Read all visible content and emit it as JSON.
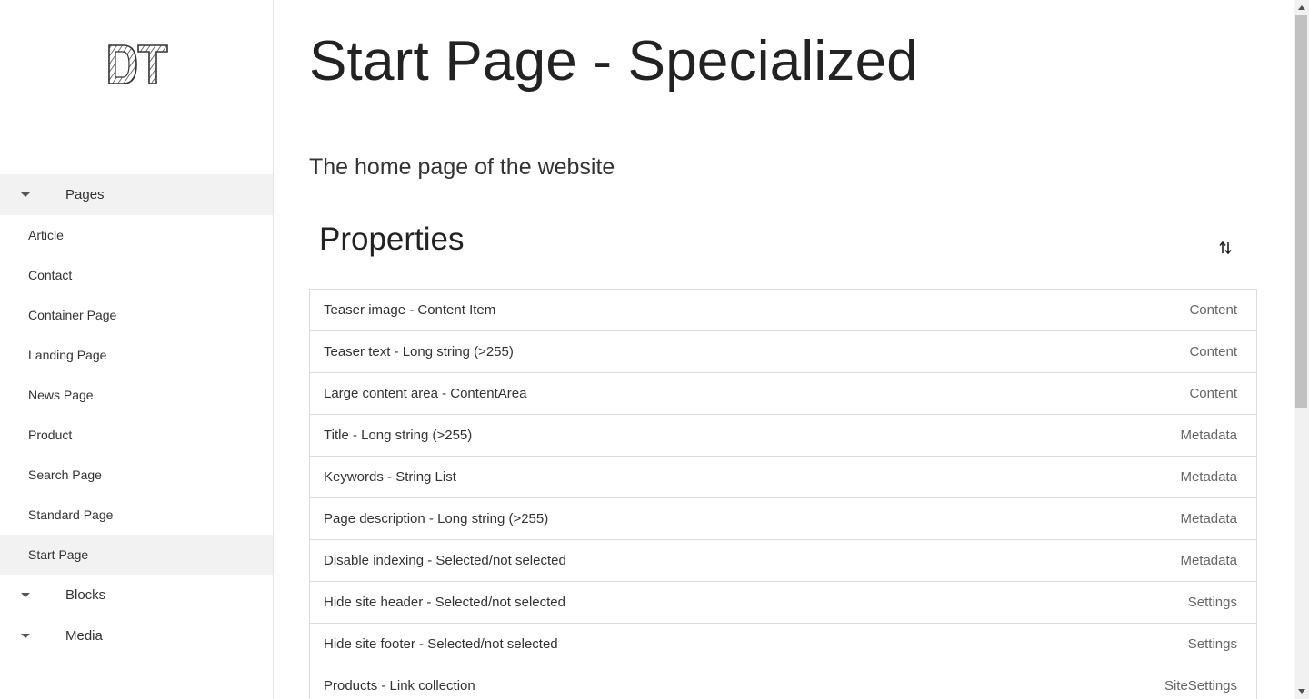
{
  "app": {
    "logo_text": "DT"
  },
  "sidebar": {
    "groups": [
      {
        "label": "Pages",
        "icon": "caret-down-icon",
        "expanded": true,
        "items": [
          {
            "label": "Article"
          },
          {
            "label": "Contact"
          },
          {
            "label": "Container Page"
          },
          {
            "label": "Landing Page"
          },
          {
            "label": "News Page"
          },
          {
            "label": "Product"
          },
          {
            "label": "Search Page"
          },
          {
            "label": "Standard Page"
          },
          {
            "label": "Start Page",
            "selected": true
          }
        ]
      },
      {
        "label": "Blocks",
        "icon": "caret-down-icon",
        "expanded": false
      },
      {
        "label": "Media",
        "icon": "caret-down-icon",
        "expanded": false
      }
    ]
  },
  "main": {
    "title": "Start Page - Specialized",
    "description": "The home page of the website",
    "properties_heading": "Properties",
    "sort_icon": "sort-icon",
    "properties": [
      {
        "name": "Teaser image - Content Item",
        "category": "Content"
      },
      {
        "name": "Teaser text - Long string (>255)",
        "category": "Content"
      },
      {
        "name": "Large content area - ContentArea",
        "category": "Content"
      },
      {
        "name": "Title - Long string (>255)",
        "category": "Metadata"
      },
      {
        "name": "Keywords - String List",
        "category": "Metadata"
      },
      {
        "name": "Page description - Long string (>255)",
        "category": "Metadata"
      },
      {
        "name": "Disable indexing - Selected/not selected",
        "category": "Metadata"
      },
      {
        "name": "Hide site header - Selected/not selected",
        "category": "Settings"
      },
      {
        "name": "Hide site footer - Selected/not selected",
        "category": "Settings"
      },
      {
        "name": "Products - Link collection",
        "category": "SiteSettings"
      }
    ]
  },
  "colors": {
    "selected_bg": "#f2f2f2",
    "border": "#dcdcdc",
    "text": "#333333",
    "muted_text": "#666666"
  }
}
